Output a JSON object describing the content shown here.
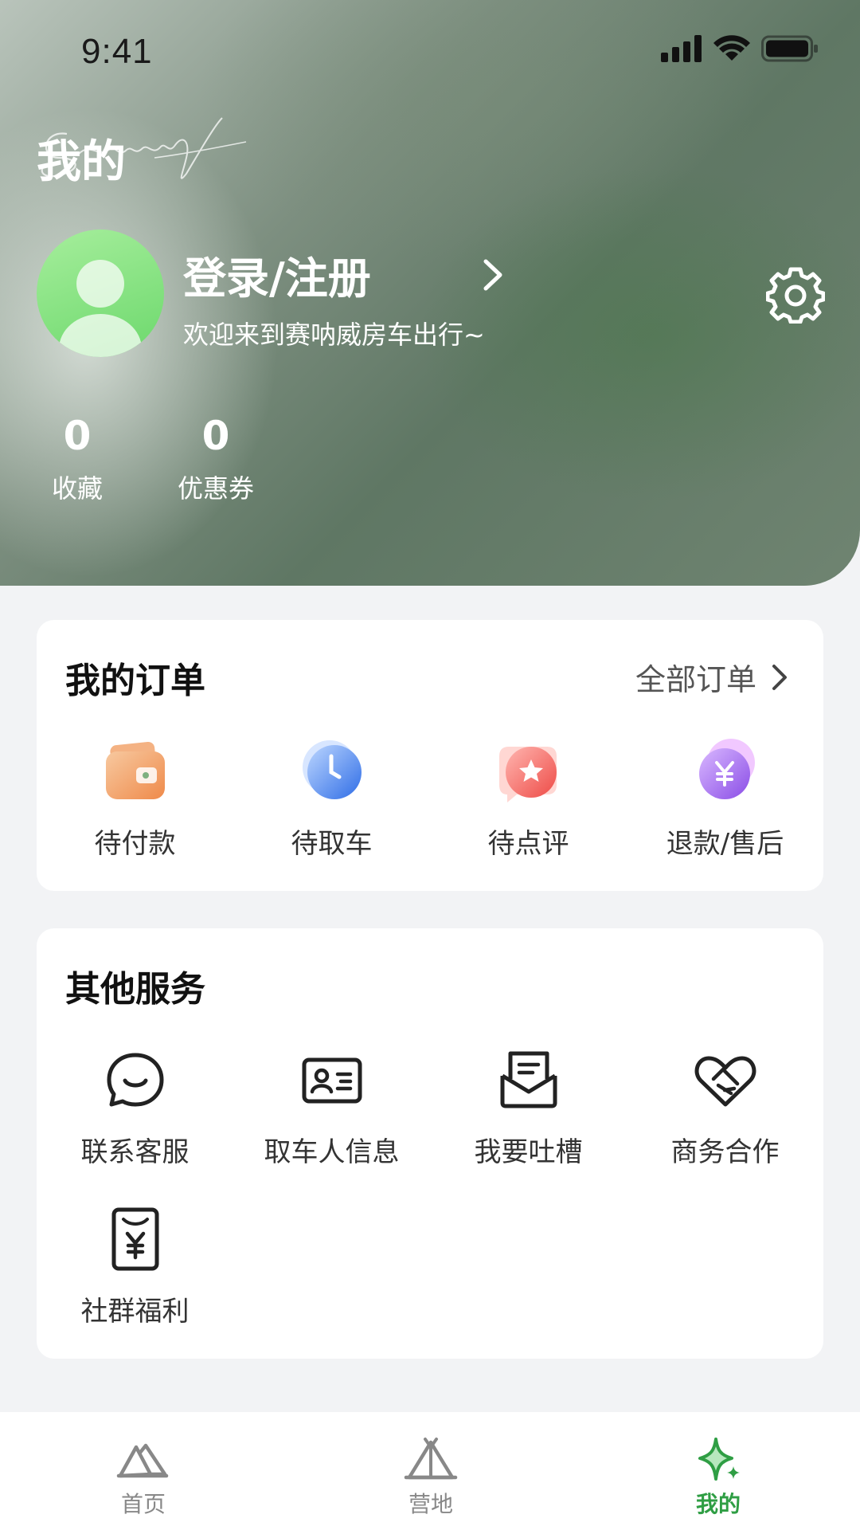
{
  "status_bar": {
    "time": "9:41"
  },
  "header": {
    "title": "我的",
    "signature": "Seranway",
    "login_label": "登录/注册",
    "welcome_text": "欢迎来到赛呐威房车出行~"
  },
  "stats": [
    {
      "value": "0",
      "label": "收藏"
    },
    {
      "value": "0",
      "label": "优惠券"
    }
  ],
  "orders": {
    "title": "我的订单",
    "all_label": "全部订单",
    "items": [
      {
        "label": "待付款",
        "icon": "wallet-icon"
      },
      {
        "label": "待取车",
        "icon": "clock-icon"
      },
      {
        "label": "待点评",
        "icon": "star-icon"
      },
      {
        "label": "退款/售后",
        "icon": "yen-icon"
      }
    ]
  },
  "services": {
    "title": "其他服务",
    "items": [
      {
        "label": "联系客服",
        "icon": "chat-icon"
      },
      {
        "label": "取车人信息",
        "icon": "id-card-icon"
      },
      {
        "label": "我要吐槽",
        "icon": "mail-open-icon"
      },
      {
        "label": "商务合作",
        "icon": "handshake-icon"
      },
      {
        "label": "社群福利",
        "icon": "receipt-yen-icon"
      }
    ]
  },
  "tabbar": {
    "items": [
      {
        "label": "首页",
        "icon": "mountain-icon",
        "active": false
      },
      {
        "label": "营地",
        "icon": "tent-icon",
        "active": false
      },
      {
        "label": "我的",
        "icon": "sparkle-icon",
        "active": true
      }
    ]
  },
  "colors": {
    "accent": "#2f9e44",
    "avatar": "#7adf73"
  }
}
